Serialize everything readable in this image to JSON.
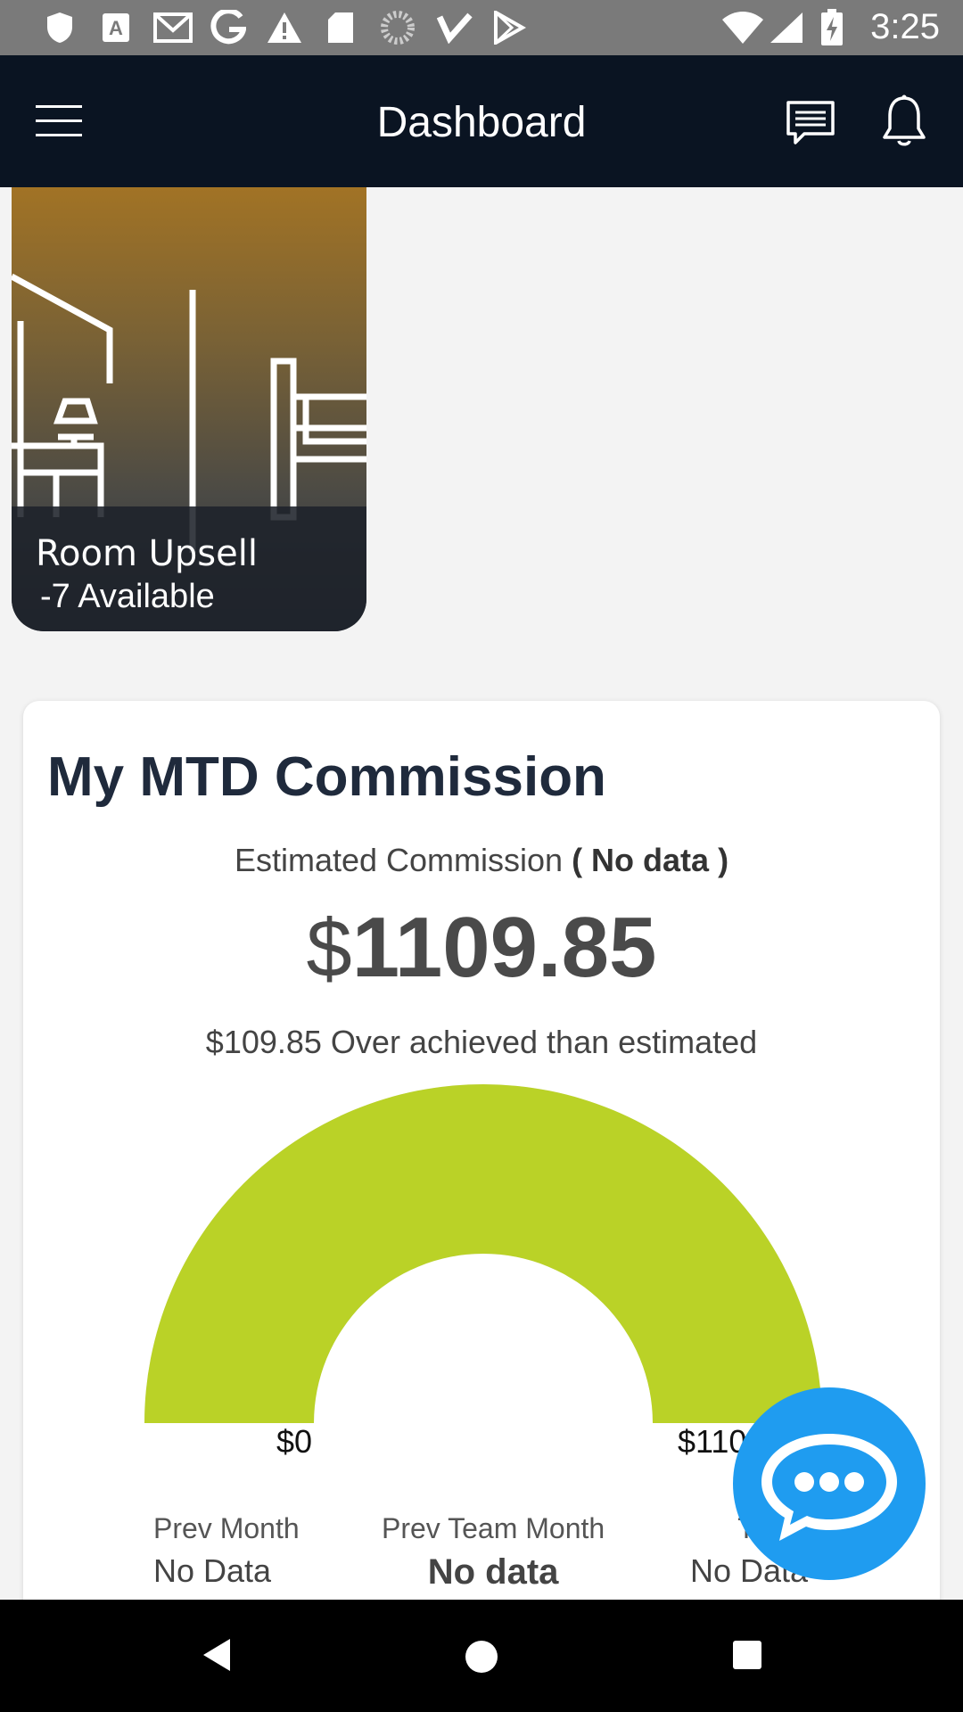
{
  "status_bar": {
    "time": "3:25",
    "icons": [
      "shield-icon",
      "font-a-icon",
      "gmail-icon",
      "google-icon",
      "warning-icon",
      "sd-card-icon",
      "loading-icon",
      "check-app-icon",
      "play-store-icon",
      "wifi-icon",
      "signal-icon",
      "battery-charging-icon"
    ]
  },
  "app_bar": {
    "title": "Dashboard",
    "icons": [
      "hamburger-menu-icon",
      "chat-icon",
      "bell-icon"
    ]
  },
  "room_upsell": {
    "title": "Room Upsell",
    "subtitle": "-7 Available"
  },
  "commission": {
    "title": "My MTD Commission",
    "estimated_label": "Estimated Commission",
    "estimated_status": "( No data )",
    "currency": "$",
    "amount": "1109.85",
    "over_text": "$109.85 Over achieved than estimated",
    "gauge": {
      "min_label": "$0",
      "max_label": "$110",
      "progress_fraction": 1.0,
      "color": "#bad227"
    },
    "stats": [
      {
        "label": "Prev Month",
        "value": "No Data"
      },
      {
        "label": "Prev Team Month",
        "value": "No data"
      },
      {
        "label": "Ti",
        "value": "No Data"
      }
    ]
  },
  "fab": {
    "icon": "chat-bubble-icon",
    "color": "#1f9cf0"
  },
  "nav_bar": {
    "icons": [
      "back-icon",
      "home-icon",
      "recents-icon"
    ]
  }
}
